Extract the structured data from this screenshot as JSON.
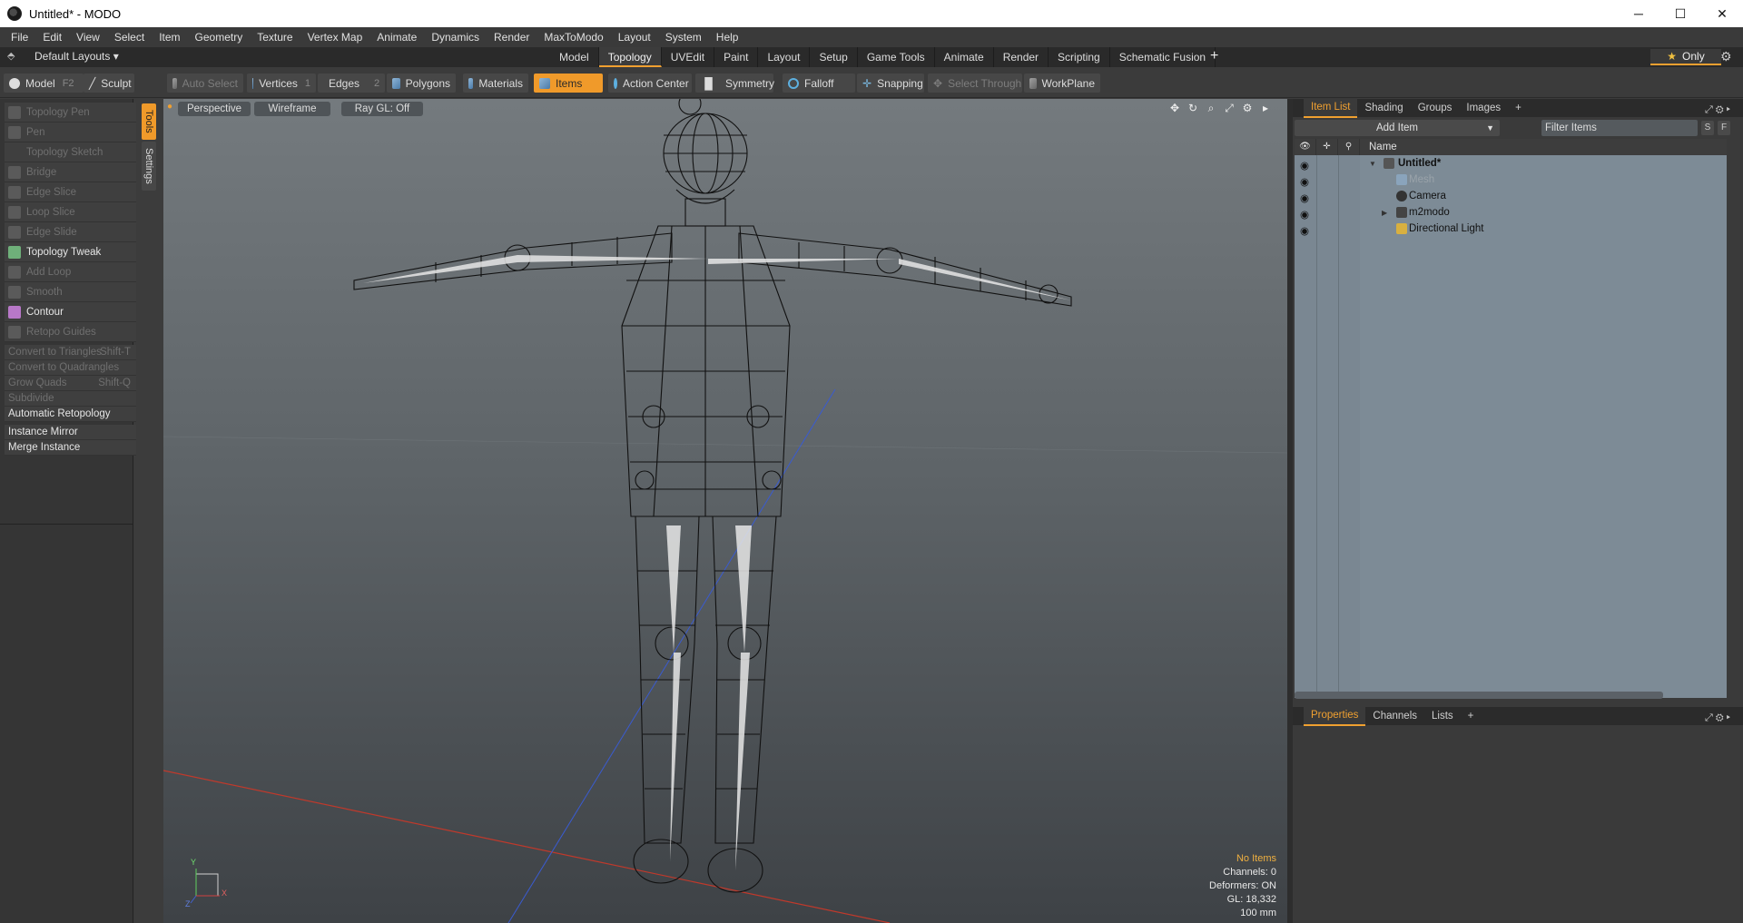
{
  "window": {
    "title": "Untitled* - MODO",
    "minimize": "─",
    "maximize": "☐",
    "close": "✕"
  },
  "menu": [
    "File",
    "Edit",
    "View",
    "Select",
    "Item",
    "Geometry",
    "Texture",
    "Vertex Map",
    "Animate",
    "Dynamics",
    "Render",
    "MaxToModo",
    "Layout",
    "System",
    "Help"
  ],
  "layoutbar": {
    "default_layouts": "Default Layouts ▾",
    "tabs": [
      "Model",
      "Topology",
      "UVEdit",
      "Paint",
      "Layout",
      "Setup",
      "Game Tools",
      "Animate",
      "Render",
      "Scripting",
      "Schematic Fusion"
    ],
    "active_tab": "Topology",
    "only": "Only"
  },
  "toolbar": {
    "model": "Model",
    "model_key": "F2",
    "sculpt": "Sculpt",
    "auto_select": "Auto Select",
    "vertices": "Vertices",
    "vertices_key": "1",
    "edges": "Edges",
    "edges_key": "2",
    "polygons": "Polygons",
    "materials": "Materials",
    "items": "Items",
    "action_center": "Action Center",
    "symmetry": "Symmetry",
    "falloff": "Falloff",
    "snapping": "Snapping",
    "select_through": "Select Through",
    "workplane": "WorkPlane"
  },
  "tools": {
    "vtab_tools": "Tools",
    "vtab_settings": "Settings",
    "items": [
      {
        "label": "Topology Pen",
        "enabled": false
      },
      {
        "label": "Pen",
        "enabled": false
      },
      {
        "label": "Topology Sketch",
        "enabled": false
      },
      {
        "label": "Bridge",
        "enabled": false
      },
      {
        "label": "Edge Slice",
        "enabled": false
      },
      {
        "label": "Loop Slice",
        "enabled": false
      },
      {
        "label": "Edge Slide",
        "enabled": false
      },
      {
        "label": "Topology Tweak",
        "enabled": true
      },
      {
        "label": "Add Loop",
        "enabled": false
      },
      {
        "label": "Smooth",
        "enabled": false
      },
      {
        "label": "Contour",
        "enabled": true
      },
      {
        "label": "Retopo Guides",
        "enabled": false
      }
    ],
    "commands": [
      {
        "label": "Convert to Triangles",
        "shortcut": "Shift-T",
        "enabled": false
      },
      {
        "label": "Convert to Quadrangles",
        "shortcut": "",
        "enabled": false
      },
      {
        "label": "Grow Quads",
        "shortcut": "Shift-Q",
        "enabled": false
      },
      {
        "label": "Subdivide",
        "shortcut": "",
        "enabled": false
      },
      {
        "label": "Automatic Retopology",
        "shortcut": "",
        "enabled": true
      }
    ],
    "instance_mirror": "Instance Mirror",
    "merge_instance": "Merge Instance"
  },
  "viewport": {
    "projection": "Perspective",
    "shading": "Wireframe",
    "raygl": "Ray GL: Off",
    "info": {
      "no_items": "No Items",
      "channels": "Channels: 0",
      "deformers": "Deformers: ON",
      "gl": "GL: 18,332",
      "scale": "100 mm"
    },
    "axis_y": "Y",
    "axis_x": "X",
    "axis_z": "Z"
  },
  "itemlist": {
    "tabs": [
      "Item List",
      "Shading",
      "Groups",
      "Images"
    ],
    "active": "Item List",
    "add_item": "Add Item",
    "filter_placeholder": "Filter Items",
    "btn_s": "S",
    "btn_f": "F",
    "col_name": "Name",
    "rows": [
      {
        "label": "Untitled*",
        "style": "bold"
      },
      {
        "label": "Mesh",
        "style": "dim"
      },
      {
        "label": "Camera",
        "style": "normal"
      },
      {
        "label": "m2modo",
        "style": "normal"
      },
      {
        "label": "Directional Light",
        "style": "normal"
      }
    ]
  },
  "properties": {
    "tabs": [
      "Properties",
      "Channels",
      "Lists"
    ],
    "active": "Properties"
  },
  "colors": {
    "accent": "#f09a2a",
    "viewport_top": "#747a7e",
    "viewport_bottom": "#3e4246",
    "tree_bg": "#7d8b96"
  }
}
